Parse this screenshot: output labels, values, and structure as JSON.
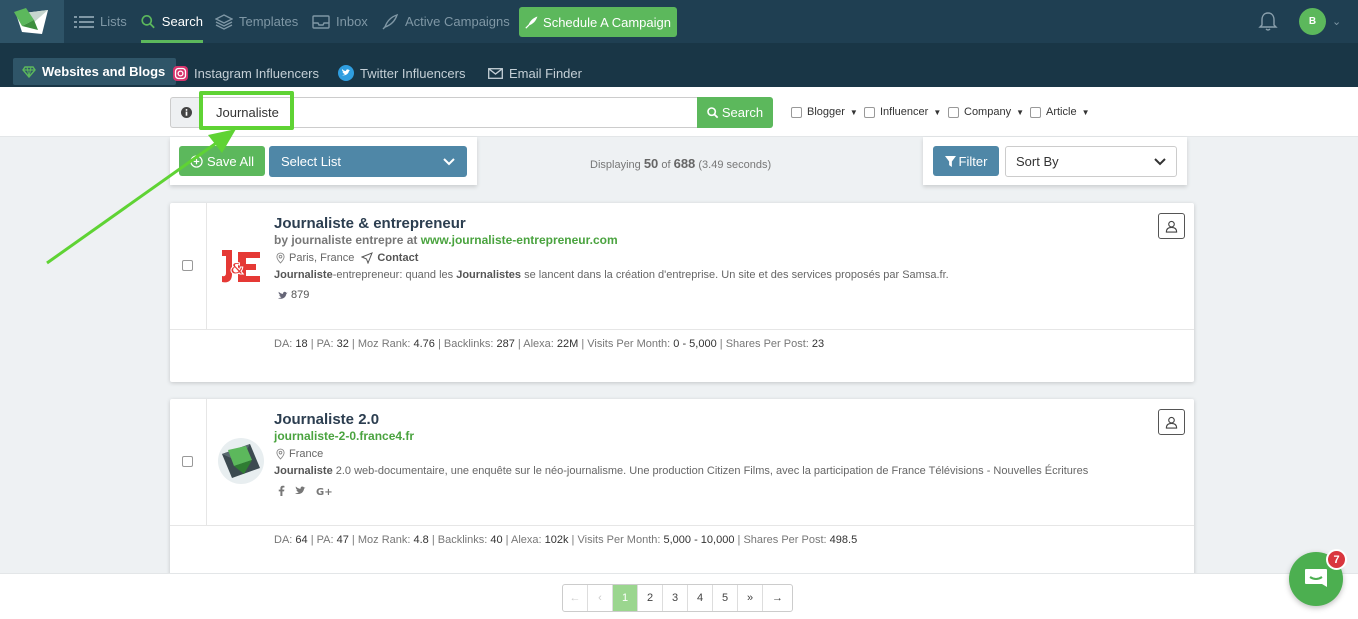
{
  "nav": {
    "items": [
      {
        "label": "Lists",
        "icon": "list-icon"
      },
      {
        "label": "Search",
        "icon": "search-icon"
      },
      {
        "label": "Templates",
        "icon": "layers-icon"
      },
      {
        "label": "Inbox",
        "icon": "inbox-icon"
      },
      {
        "label": "Active Campaigns",
        "icon": "rocket-icon"
      }
    ],
    "active": "Search",
    "schedule_label": "Schedule A Campaign",
    "avatar_initial": "B"
  },
  "subnav": {
    "items": [
      {
        "label": "Websites and Blogs",
        "icon": "gem-icon"
      },
      {
        "label": "Instagram Influencers",
        "icon": "instagram-icon"
      },
      {
        "label": "Twitter Influencers",
        "icon": "twitter-icon"
      },
      {
        "label": "Email Finder",
        "icon": "envelope-icon"
      }
    ],
    "active": "Websites and Blogs"
  },
  "search": {
    "value": "Journaliste",
    "button_label": "Search",
    "filters": [
      {
        "label": "Blogger"
      },
      {
        "label": "Influencer"
      },
      {
        "label": "Company"
      },
      {
        "label": "Article"
      }
    ]
  },
  "toolbar": {
    "save_all_label": "Save All",
    "select_list_label": "Select List",
    "displaying_prefix": "Displaying",
    "displaying_count": "50",
    "displaying_of": "of",
    "displaying_total": "688",
    "displaying_time": "(3.49 seconds)",
    "filter_label": "Filter",
    "sort_label": "Sort By"
  },
  "results": [
    {
      "title": "Journaliste & entrepreneur",
      "byline": "by journaliste entrepre at",
      "url": "www.journaliste-entrepreneur.com",
      "location": "Paris, France",
      "contact_label": "Contact",
      "desc_prefix": "Journaliste",
      "desc_mid1": "-entrepreneur: quand les ",
      "desc_bold2": "Journalistes",
      "desc_rest": " se lancent dans la création d'entreprise. Un site et des services proposés par Samsa.fr.",
      "twitter_count": "879",
      "metrics": {
        "da": "18",
        "pa": "32",
        "moz": "4.76",
        "backlinks": "287",
        "alexa": "22M",
        "visits": "0 - 5,000",
        "shares": "23"
      }
    },
    {
      "title": "Journaliste 2.0",
      "url": "journaliste-2-0.france4.fr",
      "location": "France",
      "desc_prefix": "Journaliste",
      "desc_rest": " 2.0 web-documentaire, une enquête sur le néo-journalisme. Une production Citizen Films, avec la participation de France Télévisions - Nouvelles Écritures",
      "metrics": {
        "da": "64",
        "pa": "47",
        "moz": "4.8",
        "backlinks": "40",
        "alexa": "102k",
        "visits": "5,000 - 10,000",
        "shares": "498.5"
      }
    }
  ],
  "metric_labels": {
    "da": "DA:",
    "pa": "PA:",
    "moz": "Moz Rank:",
    "backlinks": "Backlinks:",
    "alexa": "Alexa:",
    "visits": "Visits Per Month:",
    "shares": "Shares Per Post:"
  },
  "pagination": {
    "first": "←",
    "prev": "‹",
    "pages": [
      "1",
      "2",
      "3",
      "4",
      "5"
    ],
    "current": "1",
    "next": "»",
    "last": "→"
  },
  "chat": {
    "badge": "7"
  },
  "colors": {
    "nav_bg": "#1f3f52",
    "subnav_bg": "#193646",
    "accent_green": "#5cb85c",
    "button_blue": "#4f87a7",
    "highlight_green": "#5fd334",
    "badge_red": "#d9363e"
  }
}
